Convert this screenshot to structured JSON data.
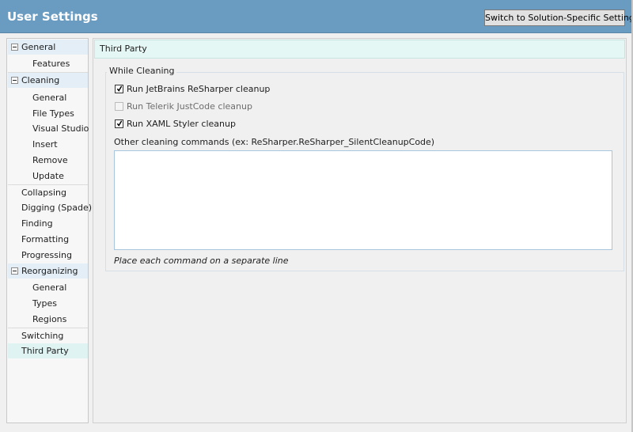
{
  "window": {
    "title": "User Settings",
    "switch_button_label": "Switch to Solution-Specific Settings"
  },
  "nav": {
    "items": [
      {
        "label": "General",
        "group": true,
        "expanded": true
      },
      {
        "label": "Features"
      },
      {
        "label": "Cleaning",
        "group": true,
        "expanded": true
      },
      {
        "label": "General"
      },
      {
        "label": "File Types"
      },
      {
        "label": "Visual Studio"
      },
      {
        "label": "Insert"
      },
      {
        "label": "Remove"
      },
      {
        "label": "Update"
      },
      {
        "label": "Collapsing"
      },
      {
        "label": "Digging (Spade)"
      },
      {
        "label": "Finding"
      },
      {
        "label": "Formatting"
      },
      {
        "label": "Progressing"
      },
      {
        "label": "Reorganizing",
        "group": true,
        "expanded": true
      },
      {
        "label": "General"
      },
      {
        "label": "Types"
      },
      {
        "label": "Regions"
      },
      {
        "label": "Switching"
      },
      {
        "label": "Third Party",
        "selected": true
      }
    ]
  },
  "page": {
    "header": "Third Party",
    "group_title": "While Cleaning",
    "options": [
      {
        "label": "Run JetBrains ReSharper cleanup",
        "checked": true,
        "enabled": true
      },
      {
        "label": "Run Telerik JustCode cleanup",
        "checked": false,
        "enabled": false
      },
      {
        "label": "Run XAML Styler cleanup",
        "checked": true,
        "enabled": true
      }
    ],
    "commands_label": "Other cleaning commands (ex: ReSharper.ReSharper_SilentCleanupCode)",
    "commands_value": "",
    "hint": "Place each command on a separate line"
  },
  "colors": {
    "titlebar": "#6a9bc0",
    "group_highlight": "#e3eef6",
    "selected_highlight": "#dff3f3",
    "header_background": "#e4f7f4"
  }
}
